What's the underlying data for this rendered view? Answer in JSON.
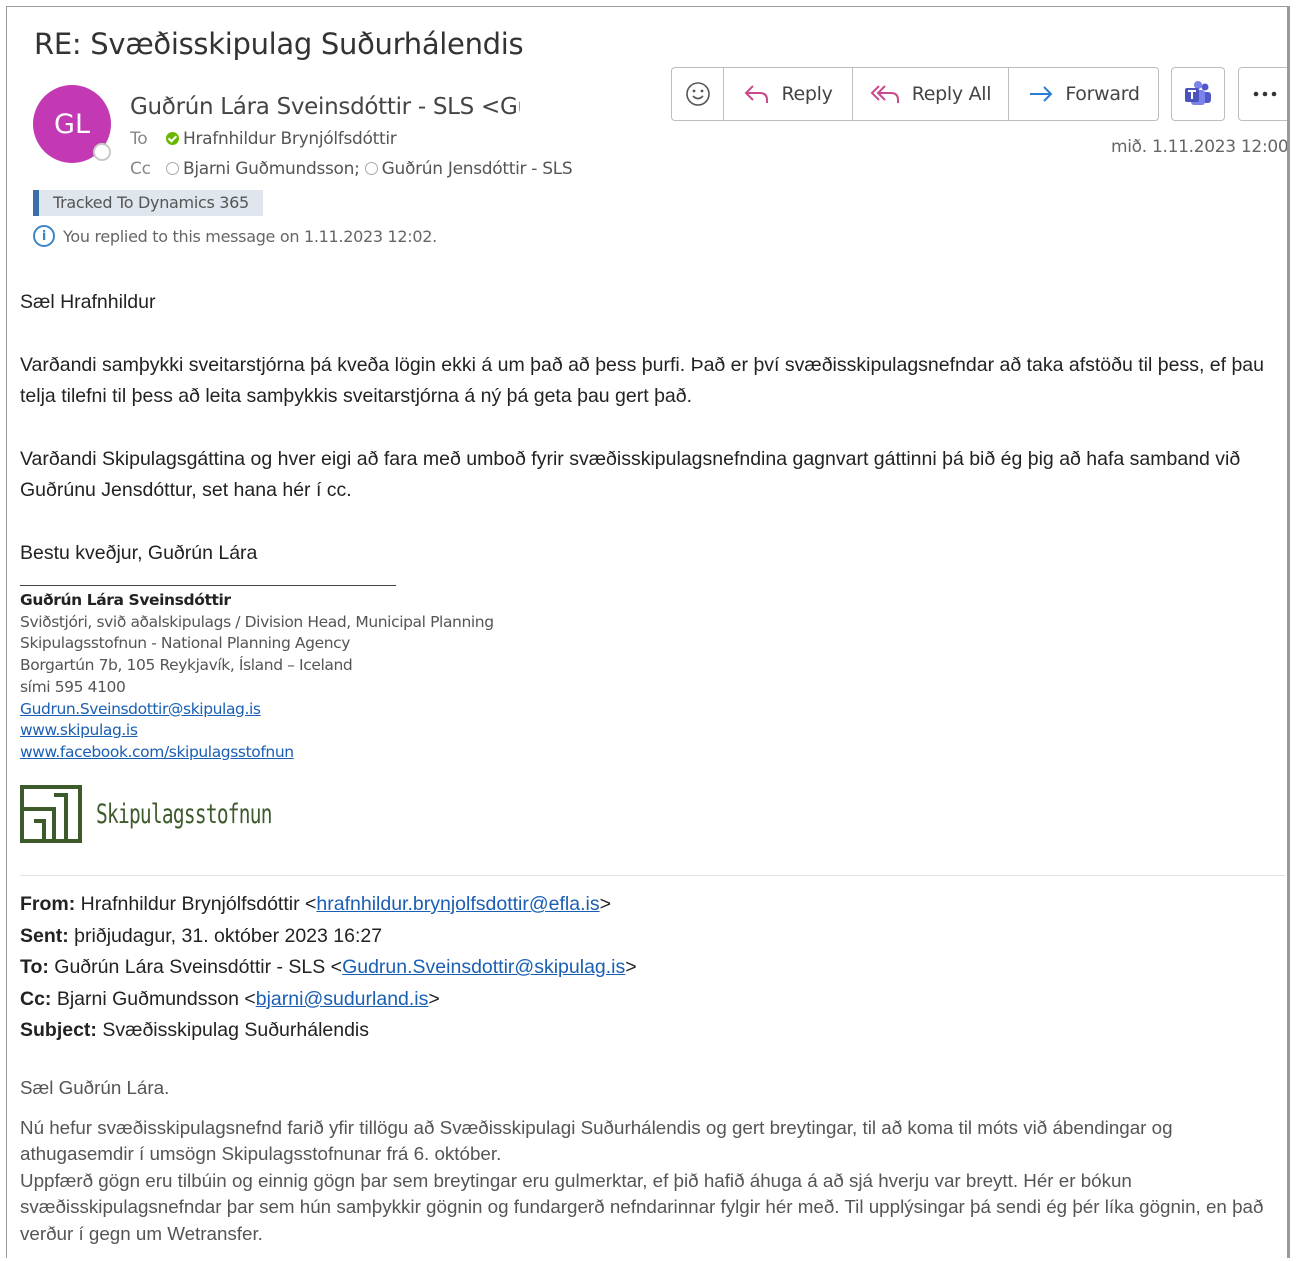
{
  "subject": "RE: Svæðisskipulag Suðurhálendis",
  "avatar_initials": "GL",
  "sender": "Guðrún Lára Sveinsdóttir - SLS <Gudrun.Sveinsdottir@skipulag.is>",
  "to_label": "To",
  "to_name": "Hrafnhildur Brynjólfsdóttir",
  "cc_label": "Cc",
  "cc_name1": "Bjarni Guðmundsson;",
  "cc_name2": "Guðrún Jensdóttir - SLS",
  "tracked": "Tracked To Dynamics 365",
  "replied": "You replied to this message on 1.11.2023 12:02.",
  "toolbar": {
    "reply": "Reply",
    "reply_all": "Reply All",
    "forward": "Forward"
  },
  "date": "mið. 1.11.2023 12:00",
  "body": {
    "greeting": "Sæl Hrafnhildur",
    "p1": "Varðandi samþykki sveitarstjórna þá kveða lögin ekki á um það að þess þurfi. Það er því svæðisskipulagsnefndar að taka afstöðu til þess, ef þau telja tilefni til þess að leita samþykkis sveitarstjórna á ný þá geta þau gert það.",
    "p2": "Varðandi Skipulagsgáttina og hver eigi að fara með umboð fyrir svæðisskipulagsnefndina gagnvart gáttinni þá bið ég þig að hafa samband við Guðrúnu Jensdóttur, set hana hér í cc.",
    "closing": "Bestu kveðjur, Guðrún Lára"
  },
  "signature": {
    "name": "Guðrún Lára Sveinsdóttir",
    "title": "Sviðstjóri, svið aðalskipulags / Division Head, Municipal Planning",
    "org": "Skipulagsstofnun - National Planning Agency",
    "address": "Borgartún 7b, 105 Reykjavík, Ísland – Iceland",
    "phone": "sími 595 4100",
    "email": "Gudrun.Sveinsdottir@skipulag.is",
    "web": "www.skipulag.is",
    "facebook": "www.facebook.com/skipulagsstofnun",
    "logo_text": "Skipulagsstofnun",
    "logo_color": "#3d5a2b"
  },
  "quoted": {
    "from_label": "From:",
    "from_name": "Hrafnhildur Brynjólfsdóttir <",
    "from_email": "hrafnhildur.brynjolfsdottir@efla.is",
    "sent_label": "Sent:",
    "sent_value": "þriðjudagur, 31. október 2023 16:27",
    "to_label": "To:",
    "to_name": "Guðrún Lára Sveinsdóttir - SLS <",
    "to_email": "Gudrun.Sveinsdottir@skipulag.is",
    "cc_label": "Cc:",
    "cc_name": "Bjarni Guðmundsson <",
    "cc_email": "bjarni@sudurland.is",
    "subject_label": "Subject:",
    "subject_value": "Svæðisskipulag Suðurhálendis",
    "greeting": "Sæl Guðrún Lára.",
    "p1": "Nú hefur svæðisskipulagsnefnd farið yfir tillögu að Svæðisskipulagi Suðurhálendis og gert breytingar, til að koma til móts við ábendingar og athugasemdir í umsögn Skipulagsstofnunar frá 6. október.",
    "p2": "Uppfærð gögn eru tilbúin og einnig gögn þar sem breytingar eru gulmerktar, ef þið hafið áhuga á að sjá hverju var breytt. Hér er bókun svæðisskipulagsnefndar þar sem hún samþykkir gögnin og fundargerð nefndarinnar fylgir hér með. Til upplýsingar þá sendi ég þér líka gögnin, en það verður í gegn um Wetransfer."
  }
}
